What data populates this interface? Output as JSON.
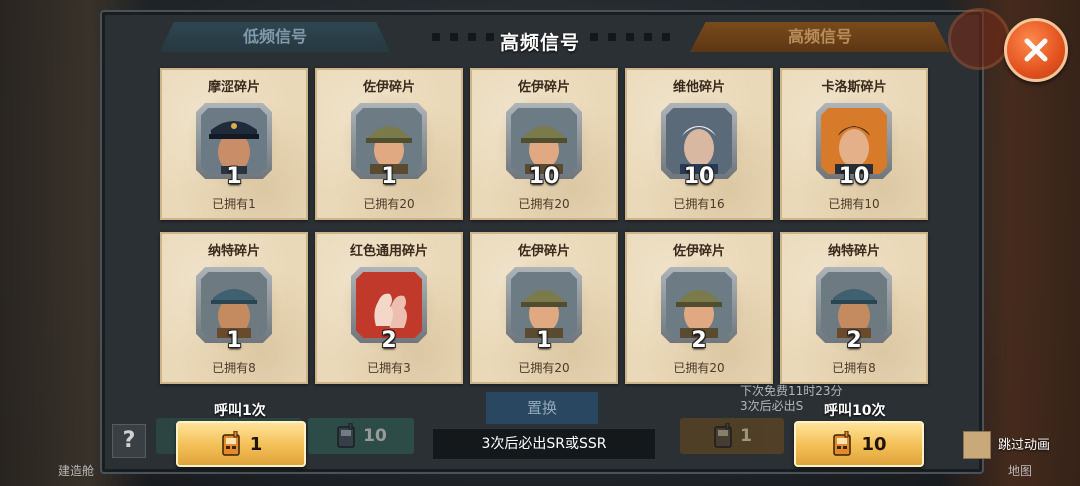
{
  "tabs": {
    "low": "低频信号",
    "high": "高频信号"
  },
  "title": "高频信号",
  "cards": [
    {
      "name": "摩涩碎片",
      "count": "1",
      "owned": "已拥有1",
      "portrait": "officer-cap"
    },
    {
      "name": "佐伊碎片",
      "count": "1",
      "owned": "已拥有20",
      "portrait": "helmet-young"
    },
    {
      "name": "佐伊碎片",
      "count": "10",
      "owned": "已拥有20",
      "portrait": "helmet-young"
    },
    {
      "name": "维他碎片",
      "count": "10",
      "owned": "已拥有16",
      "portrait": "old-man"
    },
    {
      "name": "卡洛斯碎片",
      "count": "10",
      "owned": "已拥有10",
      "portrait": "young-man"
    },
    {
      "name": "纳特碎片",
      "count": "1",
      "owned": "已拥有8",
      "portrait": "cap-rugged"
    },
    {
      "name": "红色通用碎片",
      "count": "2",
      "owned": "已拥有3",
      "portrait": "red-silhouette"
    },
    {
      "name": "佐伊碎片",
      "count": "1",
      "owned": "已拥有20",
      "portrait": "helmet-young"
    },
    {
      "name": "佐伊碎片",
      "count": "2",
      "owned": "已拥有20",
      "portrait": "helmet-young"
    },
    {
      "name": "纳特碎片",
      "count": "2",
      "owned": "已拥有8",
      "portrait": "cap-rugged"
    }
  ],
  "call_one": {
    "label": "呼叫1次",
    "cost": "1"
  },
  "call_ten": {
    "label": "呼叫10次",
    "cost": "10"
  },
  "ghost_costs": {
    "left": "10",
    "right": "1"
  },
  "replace_label": "置换",
  "notice": "3次后必出SR或SSR",
  "free_text": {
    "line1": "下次免费11时23分",
    "line2": "3次后必出S"
  },
  "skip_animation": "跳过动画",
  "help_label": "?",
  "side": {
    "left_bottom": "建造舱",
    "right_bottom": "地图"
  },
  "colors": {
    "accent_gold": "#f4c25a",
    "close_orange": "#e2521f",
    "card_bg": "#ead9b8"
  }
}
